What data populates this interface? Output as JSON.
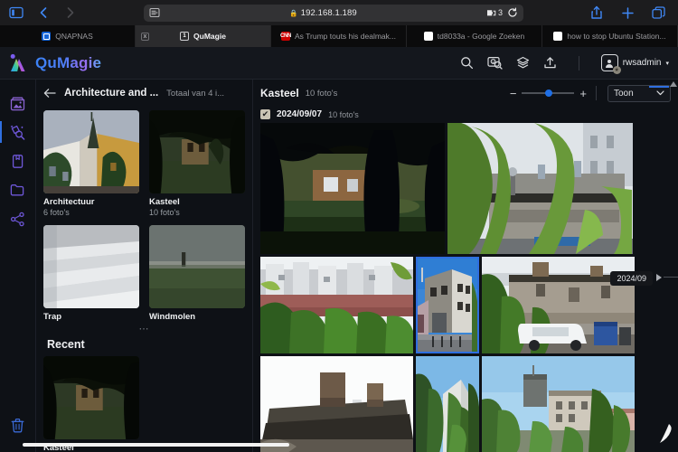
{
  "browser": {
    "url": "192.168.1.189",
    "lock_icon": "lock-icon",
    "reader_icon": "reader-view-icon",
    "extension_count": "3",
    "reload_icon": "reload-icon",
    "back_icon": "back-chevron-icon",
    "forward_icon": "forward-chevron-icon",
    "sidebar_icon": "sidebar-toggle-icon",
    "share_icon": "share-icon",
    "new_tab_icon": "plus-icon",
    "tabs_overview_icon": "tabs-overview-icon",
    "tabs": [
      {
        "title": "QNAPNAS",
        "favicon": "qnap-icon",
        "active": false
      },
      {
        "title": "QuMagie",
        "favicon": "qumagie-icon",
        "active": true,
        "close_label": "x"
      },
      {
        "title": "As Trump touts his dealmak...",
        "favicon": "cnn-icon",
        "active": false
      },
      {
        "title": "td8033a - Google Zoeken",
        "favicon": "google-icon",
        "active": false
      },
      {
        "title": "how to stop Ubuntu Station...",
        "favicon": "google-icon",
        "active": false
      }
    ]
  },
  "app": {
    "brand": "QuMagie",
    "tools": [
      {
        "name": "search-icon"
      },
      {
        "name": "face-search-icon"
      },
      {
        "name": "stack-print-icon"
      },
      {
        "name": "upload-icon"
      }
    ],
    "user": {
      "name": "rwsadmin",
      "caret": "▾",
      "badge": "★"
    }
  },
  "rail": {
    "items": [
      {
        "name": "photos-icon",
        "active": false
      },
      {
        "name": "magic-search-icon",
        "active": true
      },
      {
        "name": "albums-icon",
        "active": false
      },
      {
        "name": "folder-icon",
        "active": false
      },
      {
        "name": "share-icon",
        "active": false
      }
    ],
    "trash": {
      "name": "trash-icon"
    }
  },
  "sidebar": {
    "back_icon": "back-arrow-icon",
    "title": "Architecture and ...",
    "total": "Totaal van 4 i...",
    "albums": [
      {
        "name": "Architectuur",
        "count": "6 foto's",
        "thumb": "architectuur"
      },
      {
        "name": "Kasteel",
        "count": "10 foto's",
        "thumb": "kasteel"
      },
      {
        "name": "Trap",
        "count": "",
        "thumb": "trap"
      },
      {
        "name": "Windmolen",
        "count": "",
        "thumb": "windmolen"
      }
    ],
    "resize_handle": "⋯",
    "recent_title": "Recent",
    "recent": [
      {
        "name": "Kasteel",
        "thumb": "kasteel"
      }
    ]
  },
  "main": {
    "title": "Kasteel",
    "count": "10 foto's",
    "zoom": {
      "minus": "−",
      "plus": "+",
      "position": "44"
    },
    "view_select": {
      "label": "Toon",
      "caret": "⌄"
    },
    "date_group": {
      "checked": true,
      "check_glyph": "✔",
      "date": "2024/09/07",
      "count": "10 foto's"
    },
    "timeline": {
      "label": "2024/09"
    },
    "photos": [
      {
        "id": "p1",
        "alt": "dark-trees-park",
        "selected": false
      },
      {
        "id": "p2",
        "alt": "ruin-behind-trees",
        "selected": false
      },
      {
        "id": "p3",
        "alt": "white-building-red-roof",
        "selected": false
      },
      {
        "id": "p4",
        "alt": "corner-house-blue-sky",
        "selected": true
      },
      {
        "id": "p5",
        "alt": "ruin-with-white-car",
        "selected": false
      },
      {
        "id": "p6",
        "alt": "brick-roof-chimneys",
        "selected": false
      },
      {
        "id": "p7",
        "alt": "ivy-covered-wall",
        "selected": false
      },
      {
        "id": "p8",
        "alt": "castle-tower-trees",
        "selected": false
      }
    ],
    "pencil_icon": "pencil-icon"
  }
}
